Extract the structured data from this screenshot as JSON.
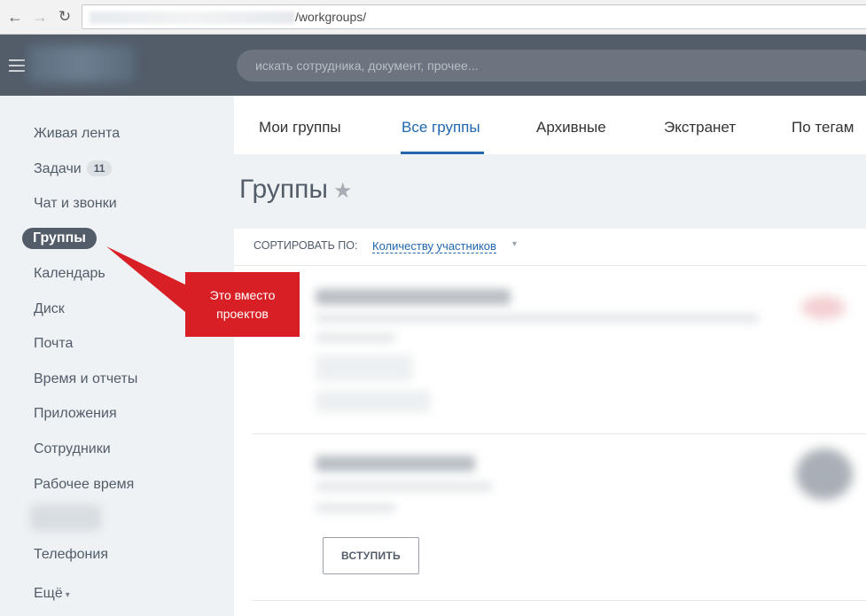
{
  "browser": {
    "url_path": "/workgroups/",
    "back_glyph": "←",
    "forward_glyph": "→",
    "reload_glyph": "↻"
  },
  "header": {
    "search_placeholder": "искать сотрудника, документ, прочее..."
  },
  "sidebar": {
    "items": [
      {
        "label": "Живая лента"
      },
      {
        "label": "Задачи",
        "badge": "11"
      },
      {
        "label": "Чат и звонки"
      },
      {
        "label": "Группы",
        "active": true
      },
      {
        "label": "Календарь"
      },
      {
        "label": "Диск"
      },
      {
        "label": "Почта"
      },
      {
        "label": "Время и отчеты"
      },
      {
        "label": "Приложения"
      },
      {
        "label": "Сотрудники"
      },
      {
        "label": "Рабочее время"
      },
      {
        "label": "Телефония"
      },
      {
        "label": "Ещё"
      }
    ],
    "more_arrow": "▾"
  },
  "tabs": [
    {
      "label": "Мои группы"
    },
    {
      "label": "Все группы",
      "active": true
    },
    {
      "label": "Архивные"
    },
    {
      "label": "Экстранет"
    },
    {
      "label": "По тегам"
    }
  ],
  "page": {
    "title": "Группы",
    "star": "★"
  },
  "sort": {
    "label": "СОРТИРОВАТЬ ПО:",
    "value": "Количеству участников",
    "arrow": "▾"
  },
  "groups": {
    "join_label": "ВСТУПИТЬ"
  },
  "annotation": {
    "text": "Это вместо проектов"
  },
  "colors": {
    "header_bg": "#535c69",
    "accent": "#2067b0",
    "annotation": "#d91f26"
  }
}
